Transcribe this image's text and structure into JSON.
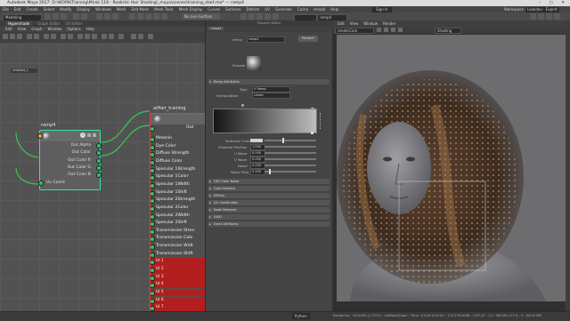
{
  "window": {
    "title": "Autodesk Maya 2017: D:\\WORK\\Training\\Mirok 118 - Realistic Hair Shading\\_maya\\scenes\\training_start.ma* --- ramp4",
    "menu": [
      "File",
      "Edit",
      "Create",
      "Select",
      "Modify",
      "Display",
      "Windows",
      "Mesh",
      "Edit Mesh",
      "Mesh Tools",
      "Mesh Display",
      "Curves",
      "Surfaces",
      "Deform",
      "UV",
      "Generate",
      "Cache",
      "Arnold",
      "Help"
    ],
    "sign_in": "Sign In",
    "workspace_label": "Workspace :",
    "workspace_value": "Lookdev - Expert"
  },
  "shelf": {
    "mode": "Modeling",
    "live_surface": "No Live Surface"
  },
  "hypershade": {
    "tabs": [
      "Hypershade",
      "Graph Editor",
      "UV Editor"
    ],
    "menu": [
      "Edit",
      "View",
      "Graph",
      "Window",
      "Options",
      "Help"
    ],
    "graph_tab": "Untitled_1",
    "ramp_node": {
      "title": "ramp4",
      "attrs": [
        "Out Alpha",
        "Out Color",
        "Out Color R",
        "Out Color G",
        "Out Color B",
        "Uv Coord"
      ]
    },
    "hair_node": {
      "title": "aiHair_training",
      "out": "Out",
      "attrs": [
        "Melanin",
        "Dye Color",
        "Diffuse Strength",
        "Diffuse Color",
        "Specular 1Strength",
        "Specular 1Color",
        "Specular 1Width",
        "Specular 1Shift",
        "Specular 2Strength",
        "Specular 2Color",
        "Specular 2Width",
        "Specular 2Shift",
        "Transmission Stren",
        "Transmission Colo",
        "Transmission Widt",
        "Transmission Shift",
        "Id 1",
        "Id 2",
        "Id 3",
        "Id 4",
        "Id 5",
        "Id 6",
        "Id 7",
        "Id 8"
      ]
    }
  },
  "attribute_editor": {
    "title": "Property Editor",
    "tab": "ramp4",
    "ramp_label": "ramp:",
    "ramp_value": "ramp4",
    "presets": "Presets*",
    "sample_label": "Sample",
    "section_open": "Ramp Attributes",
    "type_label": "Type",
    "type_value": "V Ramp",
    "interp_label": "Interpolation",
    "interp_value": "Linear",
    "selected_color": "Selected Color",
    "selected_position": "Selected Position",
    "selected_position_value": "1.000",
    "u_wave": "U Wave",
    "v_wave": "V Wave",
    "noise": "Noise",
    "noise_freq": "Noise Freq",
    "zero": "0.000",
    "noise_freq_value": "0.500",
    "sections": [
      "HSV Color Noise",
      "Color Balance",
      "Effects",
      "UV Coordinates",
      "Node Behavior",
      "UUID",
      "Extra Attributes"
    ]
  },
  "viewport": {
    "menu": [
      "Edit",
      "View",
      "Window",
      "Render"
    ],
    "camera": "renderCam",
    "mode": "Shading"
  },
  "status": {
    "mel": "Python",
    "info": "Rendering : 419x300 (1.4791) : aiAINaisShape :  Time: 1/12/6 0:00.00 : 175,276.5048 : 1,99,15 : 1,5 : MB Mill 177.6 ; 5 : 04:52 MB"
  },
  "colors": {
    "selected_node_border": "#39e39c",
    "active_node_border": "#e04040",
    "connection": "#36c957",
    "error_row": "#b21e1e",
    "plug_orange": "#f0a030"
  }
}
